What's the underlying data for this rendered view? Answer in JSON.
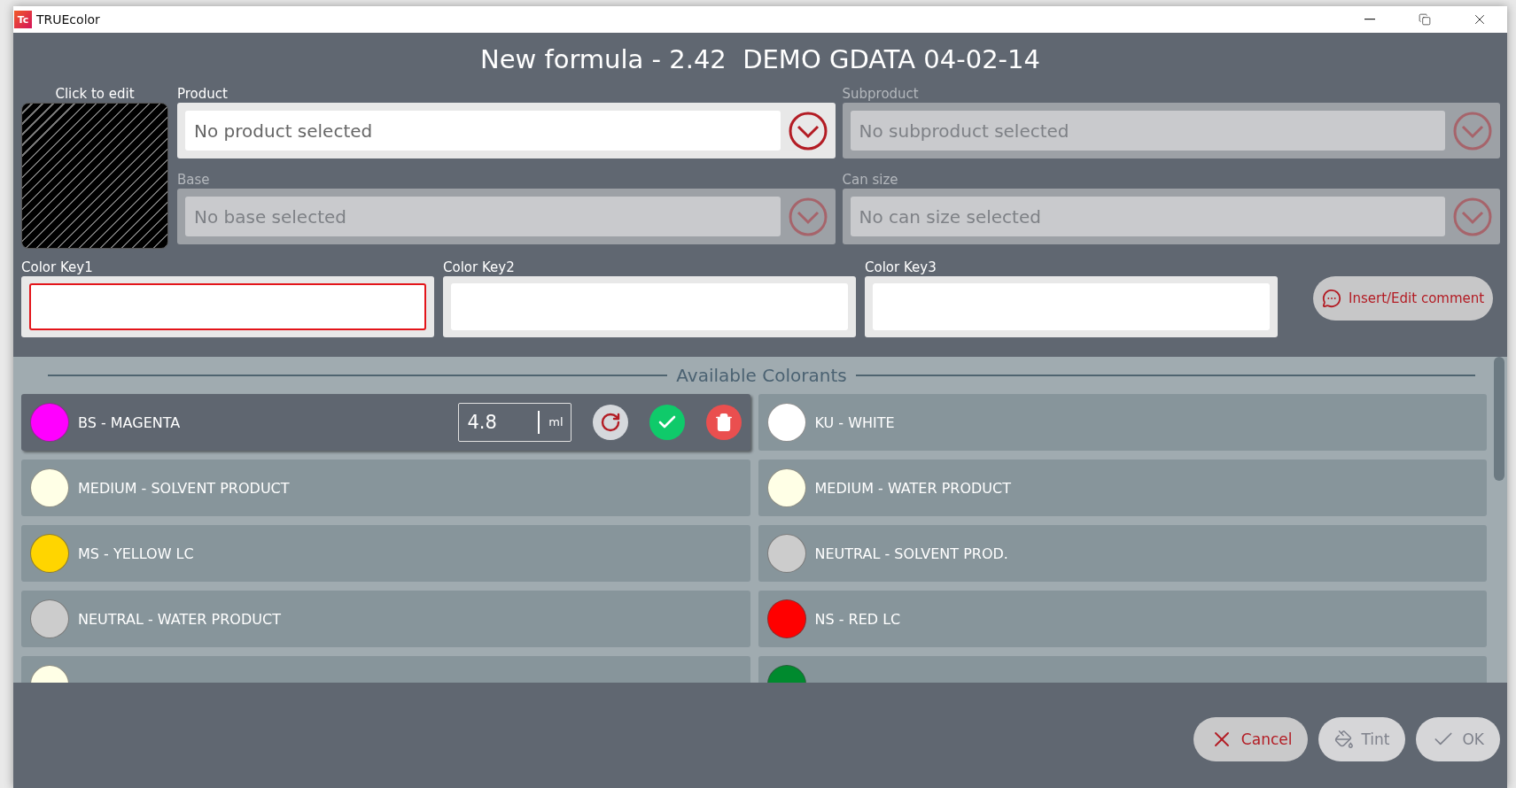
{
  "window": {
    "logo": "Tc",
    "title": "TRUEcolor"
  },
  "header": {
    "title": "New formula - 2.42  DEMO GDATA 04-02-14"
  },
  "swatch": {
    "label": "Click to edit"
  },
  "selectors": [
    {
      "label": "Product",
      "placeholder": "No product selected",
      "disabled": false
    },
    {
      "label": "Subproduct",
      "placeholder": "No subproduct selected",
      "disabled": true
    },
    {
      "label": "Base",
      "placeholder": "No base selected",
      "disabled": true
    },
    {
      "label": "Can size",
      "placeholder": "No can size selected",
      "disabled": true
    }
  ],
  "color_keys": [
    {
      "label": "Color Key1",
      "invalid": true
    },
    {
      "label": "Color Key2",
      "invalid": false
    },
    {
      "label": "Color Key3",
      "invalid": false
    }
  ],
  "comment_button": {
    "label": "Insert/Edit comment"
  },
  "colorants": {
    "title": "Available Colorants",
    "items": [
      {
        "name": "BS - MAGENTA",
        "color": "#ff00ff",
        "editing": true,
        "amount": "4.8",
        "unit": "ml"
      },
      {
        "name": "KU - WHITE",
        "color": "#ffffff",
        "editing": false
      },
      {
        "name": "MEDIUM - SOLVENT PRODUCT",
        "color": "#ffffe6",
        "editing": false
      },
      {
        "name": "MEDIUM - WATER PRODUCT",
        "color": "#ffffe6",
        "editing": false
      },
      {
        "name": "MS - YELLOW LC",
        "color": "#ffd500",
        "editing": false
      },
      {
        "name": "NEUTRAL - SOLVENT PROD.",
        "color": "#cccccc",
        "editing": false
      },
      {
        "name": "NEUTRAL - WATER PRODUCT",
        "color": "#cccccc",
        "editing": false
      },
      {
        "name": "NS - RED LC",
        "color": "#ff0000",
        "editing": false
      },
      {
        "color": "#ffffe6",
        "editing": false
      },
      {
        "color": "#008a2e",
        "editing": false
      }
    ]
  },
  "buttons": [
    {
      "label": "Cancel",
      "kind": "cancel",
      "disabled": false
    },
    {
      "label": "Tint",
      "kind": "tint",
      "disabled": true
    },
    {
      "label": "OK",
      "kind": "ok",
      "disabled": true
    }
  ]
}
